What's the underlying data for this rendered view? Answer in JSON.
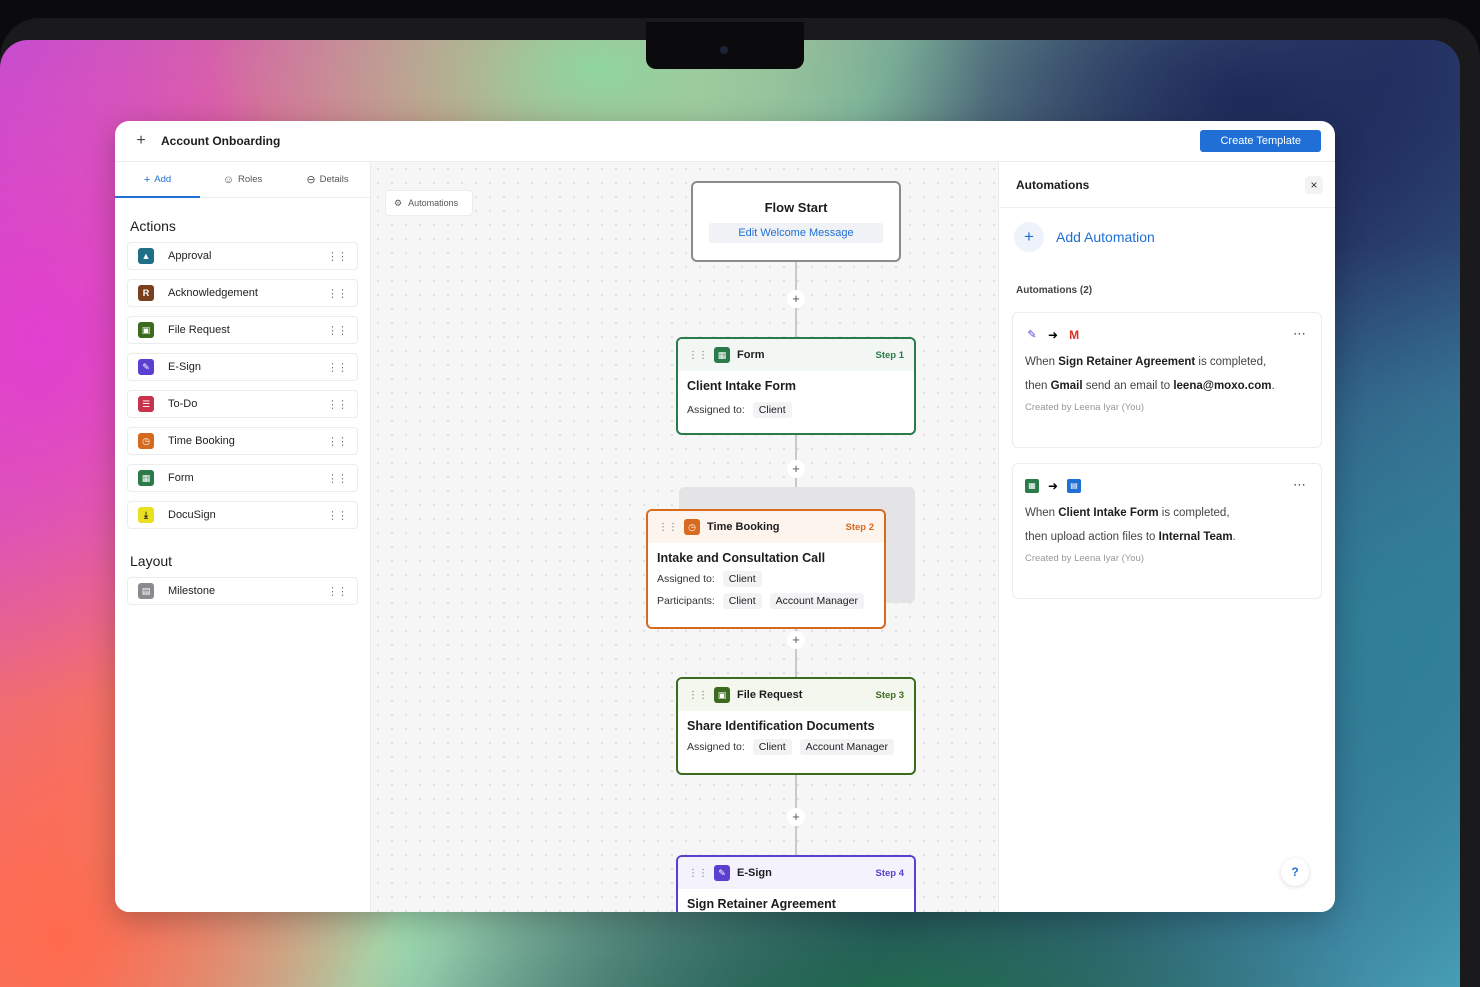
{
  "window": {
    "title": "Account Onboarding",
    "create_label": "Create Template"
  },
  "sidebar": {
    "tabs": [
      {
        "label": "Add",
        "icon": "plus-icon"
      },
      {
        "label": "Roles",
        "icon": "roles-icon"
      },
      {
        "label": "Details",
        "icon": "details-icon"
      }
    ],
    "actions_title": "Actions",
    "actions": [
      {
        "label": "Approval",
        "icon": "approval-icon",
        "color": "#1f6f87"
      },
      {
        "label": "Acknowledgement",
        "icon": "acknowledgement-icon",
        "color": "#7a3f1d"
      },
      {
        "label": "File Request",
        "icon": "file-request-icon",
        "color": "#3c6b1f"
      },
      {
        "label": "E-Sign",
        "icon": "esign-icon",
        "color": "#5a3fd0"
      },
      {
        "label": "To-Do",
        "icon": "todo-icon",
        "color": "#c8324a"
      },
      {
        "label": "Time Booking",
        "icon": "time-booking-icon",
        "color": "#d66a1f"
      },
      {
        "label": "Form",
        "icon": "form-icon",
        "color": "#2a7a4a"
      },
      {
        "label": "DocuSign",
        "icon": "docusign-icon",
        "color": "#e8e020"
      }
    ],
    "layout_title": "Layout",
    "layout": [
      {
        "label": "Milestone",
        "icon": "milestone-icon",
        "color": "#8a8a8f"
      }
    ]
  },
  "canvas": {
    "automations_chip": "Automations",
    "flow_start": {
      "title": "Flow Start",
      "edit_label": "Edit Welcome Message"
    },
    "steps": [
      {
        "type": "Form",
        "step": "Step 1",
        "name": "Client Intake Form",
        "assigned_label": "Assigned to:",
        "assigned": [
          "Client"
        ],
        "color": "#2a7a4a"
      },
      {
        "type": "Time Booking",
        "step": "Step 2",
        "name": "Intake and Consultation Call",
        "assigned_label": "Assigned to:",
        "assigned": [
          "Client"
        ],
        "participants_label": "Participants:",
        "participants": [
          "Client",
          "Account Manager"
        ],
        "color": "#d66a1f"
      },
      {
        "type": "File Request",
        "step": "Step 3",
        "name": "Share Identification Documents",
        "assigned_label": "Assigned to:",
        "assigned": [
          "Client",
          "Account Manager"
        ],
        "color": "#3c6b1f"
      },
      {
        "type": "E-Sign",
        "step": "Step 4",
        "name": "Sign Retainer Agreement",
        "color": "#5a3fd0"
      }
    ]
  },
  "panel": {
    "title": "Automations",
    "add_label": "Add Automation",
    "count_label": "Automations (2)",
    "items": [
      {
        "when_prefix": "When ",
        "when_bold": "Sign Retainer Agreement",
        "when_suffix": " is completed,",
        "then_prefix": "then ",
        "then_bold": "Gmail",
        "then_mid": " send an email to ",
        "then_bold2": "leena@moxo.com",
        "then_suffix": ".",
        "created": "Created by Leena Iyar (You)"
      },
      {
        "when_prefix": "When ",
        "when_bold": "Client Intake Form",
        "when_suffix": " is completed,",
        "then_prefix": "then upload action files to ",
        "then_bold": "Internal Team",
        "then_suffix": ".",
        "created": "Created by Leena Iyar (You)"
      }
    ],
    "help_label": "?"
  }
}
